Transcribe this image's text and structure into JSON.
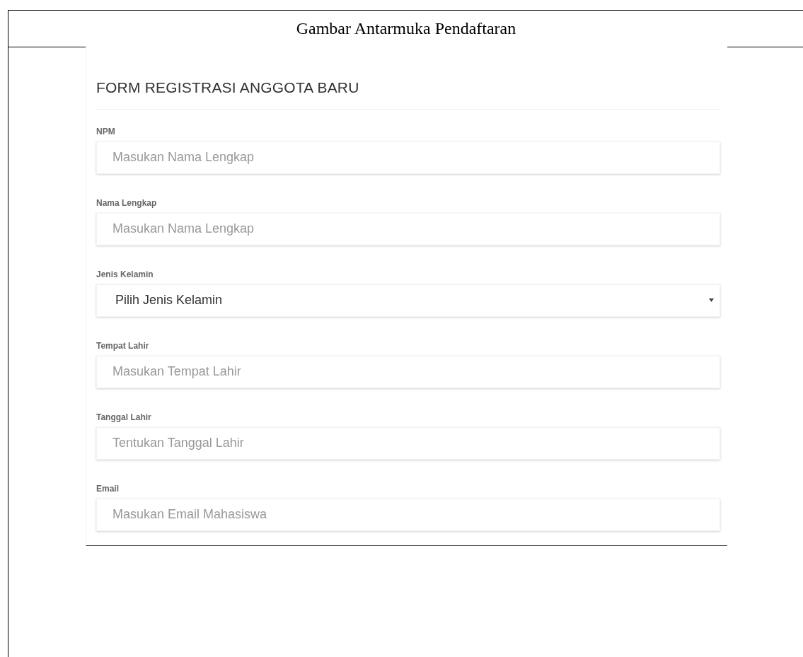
{
  "caption": "Gambar Antarmuka Pendaftaran",
  "form": {
    "title": "FORM REGISTRASI ANGGOTA BARU",
    "fields": [
      {
        "kind": "text",
        "label": "NPM",
        "placeholder": "Masukan Nama Lengkap"
      },
      {
        "kind": "text",
        "label": "Nama Lengkap",
        "placeholder": "Masukan Nama Lengkap"
      },
      {
        "kind": "select",
        "label": "Jenis Kelamin",
        "value": "Pilih Jenis Kelamin"
      },
      {
        "kind": "text",
        "label": "Tempat Lahir",
        "placeholder": "Masukan Tempat Lahir"
      },
      {
        "kind": "text",
        "label": "Tanggal Lahir",
        "placeholder": "Tentukan Tanggal Lahir"
      },
      {
        "kind": "text",
        "label": "Email",
        "placeholder": "Masukan Email Mahasiswa"
      }
    ]
  }
}
